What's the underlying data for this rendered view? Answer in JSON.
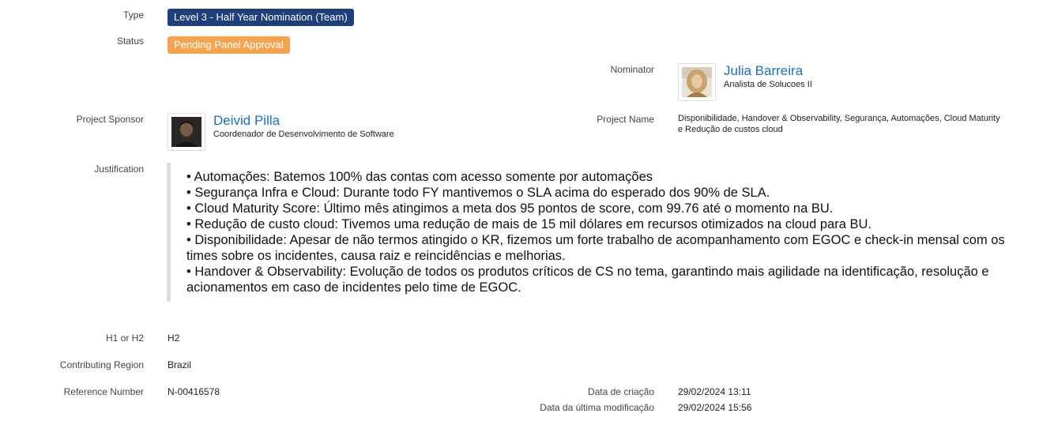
{
  "fields": {
    "type_label": "Type",
    "type_value": "Level 3 - Half Year Nomination (Team)",
    "status_label": "Status",
    "status_value": "Pending Panel Approval",
    "nominator_label": "Nominator",
    "project_sponsor_label": "Project Sponsor",
    "project_name_label": "Project Name",
    "project_name_value": "Disponibilidade, Handover & Observability, Segurança, Automações, Cloud Maturity e Redução de custos cloud",
    "justification_label": "Justification",
    "h1h2_label": "H1 or H2",
    "h1h2_value": "H2",
    "region_label": "Contributing Region",
    "region_value": "Brazil",
    "reference_label": "Reference Number",
    "reference_value": "N-00416578",
    "created_label": "Data de criação",
    "created_value": "29/02/2024 13:11",
    "modified_label": "Data da última modificação",
    "modified_value": "29/02/2024 15:56"
  },
  "nominator": {
    "name": "Julia Barreira",
    "title": "Analista de Solucoes II"
  },
  "sponsor": {
    "name": "Deivid Pilla",
    "title": "Coordenador de Desenvolvimento de Software"
  },
  "justification": [
    "• Automações: Batemos 100% das contas com acesso somente por automações",
    "• Segurança Infra e Cloud: Durante todo FY mantivemos o SLA acima do esperado dos 90% de SLA.",
    "• Cloud Maturity Score: Último mês atingimos a meta dos 95 pontos de score, com 99.76 até o momento na BU.",
    "• Redução de custo cloud: Tivemos uma redução de mais de 15 mil dólares em recursos otimizados na cloud para BU.",
    "• Disponibilidade: Apesar de não termos atingido o KR, fizemos um forte trabalho de acompanhamento com EGOC e check-in mensal com os times sobre os incidentes, causa raiz e reincidências e melhorias.",
    "• Handover & Observability: Evolução de todos os produtos críticos de CS no tema, garantindo mais agilidade na identificação, resolução e acionamentos em caso de incidentes pelo time de EGOC."
  ],
  "colors": {
    "type_badge": "#1f3f7a",
    "status_badge": "#f4a450",
    "link": "#1a6fb5"
  },
  "icons": {
    "nominator_avatar": "avatar-photo",
    "sponsor_avatar": "avatar-photo"
  }
}
